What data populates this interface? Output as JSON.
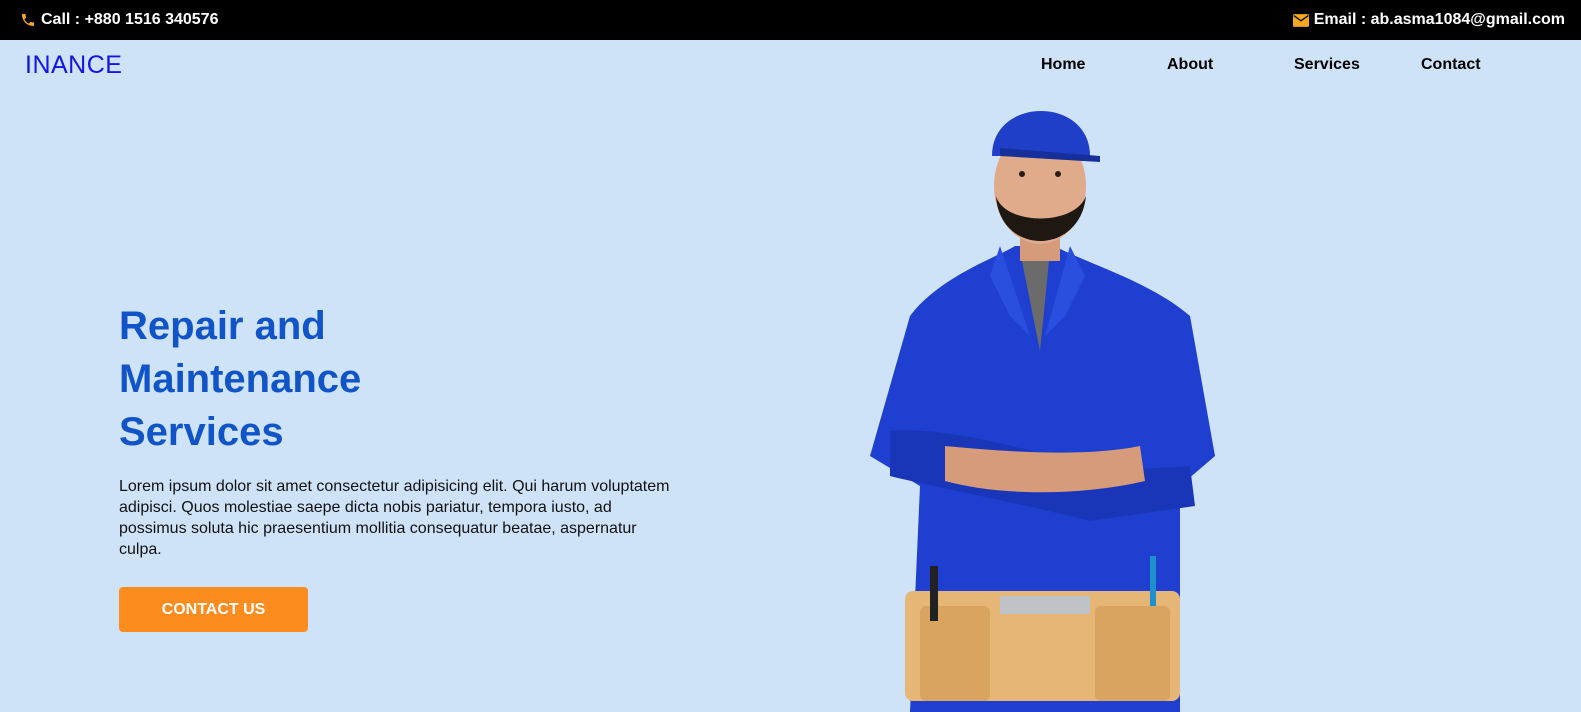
{
  "topbar": {
    "call_icon": "phone-icon",
    "call_text": "Call : +880 1516 340576",
    "email_icon": "envelope-icon",
    "email_text": "Email : ab.asma1084@gmail.com",
    "icon_color": "#f5a623"
  },
  "header": {
    "brand": "INANCE",
    "nav": [
      "Home",
      "About",
      "Services",
      "Contact"
    ]
  },
  "hero": {
    "title": "Repair and Maintenance Services",
    "description": "Lorem ipsum dolor sit amet consectetur adipisicing elit. Qui harum voluptatem adipisci. Quos molestiae saepe dicta nobis pariatur, tempora iusto, ad possimus soluta hic praesentium mollitia consequatur beatae, aspernatur culpa.",
    "cta_label": "CONTACT US",
    "image": "repairman-photo"
  },
  "colors": {
    "background": "#cfe3f8",
    "topbar": "#000000",
    "brand": "#1414e6",
    "title": "#1154c8",
    "cta": "#fd8c1f"
  }
}
